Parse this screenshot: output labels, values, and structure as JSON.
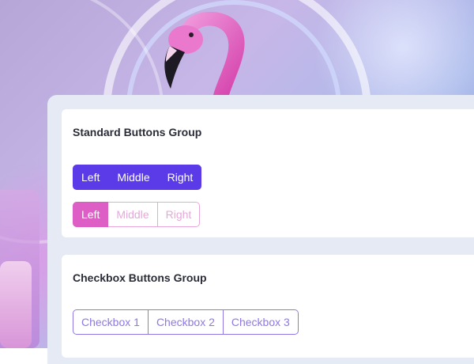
{
  "standard_group": {
    "title": "Standard Buttons Group",
    "primary": [
      "Left",
      "Middle",
      "Right"
    ],
    "outline": [
      "Left",
      "Middle",
      "Right"
    ]
  },
  "checkbox_group": {
    "title": "Checkbox Buttons Group",
    "items": [
      "Checkbox 1",
      "Checkbox 2",
      "Checkbox 3"
    ]
  },
  "colors": {
    "primary": "#5b3be8",
    "pink": "#dd5fc6",
    "pink_outline": "#e9a6dc",
    "checkbox_outline": "#8f78e6",
    "panel_bg": "#e5eaf5"
  },
  "background": {
    "subject": "flamingo-icon"
  }
}
